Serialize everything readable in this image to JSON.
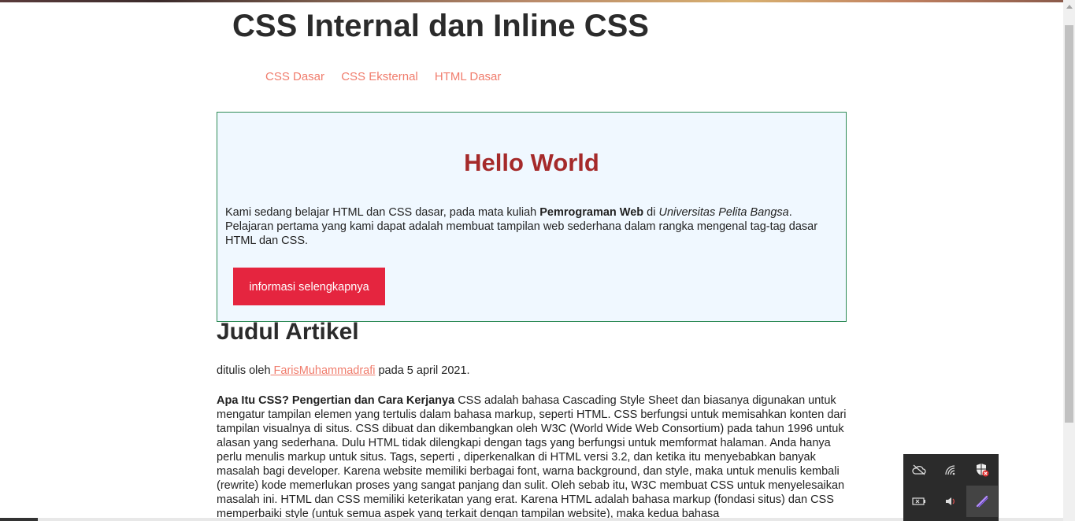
{
  "page": {
    "title": "CSS Internal dan Inline CSS",
    "nav": [
      "CSS Dasar",
      "CSS Eksternal",
      "HTML Dasar"
    ]
  },
  "hero": {
    "heading": "Hello World",
    "text_before": "Kami sedang belajar HTML dan CSS dasar, pada mata kuliah ",
    "bold_course": "Pemrograman Web",
    "text_mid": " di ",
    "italic_univ": "Universitas Pelita Bangsa",
    "text_after": ". Pelajaran pertama yang kami dapat adalah membuat tampilan web sederhana dalam rangka mengenal tag-tag dasar HTML dan CSS.",
    "button_label": "informasi selengkapnya"
  },
  "article": {
    "title": "Judul Artikel",
    "byline_prefix": "ditulis oleh",
    "author": " FarisMuhammadrafi",
    "byline_suffix": " pada 5 april 2021.",
    "lead_bold": "Apa Itu CSS? Pengertian dan Cara Kerjanya",
    "body": " CSS adalah bahasa Cascading Style Sheet dan biasanya digunakan untuk mengatur tampilan elemen yang tertulis dalam bahasa markup, seperti HTML. CSS berfungsi untuk memisahkan konten dari tampilan visualnya di situs. CSS dibuat dan dikembangkan oleh W3C (World Wide Web Consortium) pada tahun 1996 untuk alasan yang sederhana. Dulu HTML tidak dilengkapi dengan tags yang berfungsi untuk memformat halaman. Anda hanya perlu menulis markup untuk situs. Tags, seperti , diperkenalkan di HTML versi 3.2, dan ketika itu menyebabkan banyak masalah bagi developer. Karena website memiliki berbagai font, warna background, dan style, maka untuk menulis kembali (rewrite) kode memerlukan proses yang sangat panjang dan sulit. Oleh sebab itu, W3C membuat CSS untuk menyelesaikan masalah ini. HTML dan CSS memiliki keterikatan yang erat. Karena HTML adalah bahasa markup (fondasi situs) dan CSS memperbaiki style (untuk semua aspek yang terkait dengan tampilan website), maka kedua bahasa"
  },
  "tray": {
    "icons": [
      "cloud-offline-icon",
      "wifi-icon",
      "security-shield-icon",
      "battery-icon",
      "volume-icon",
      "pen-icon"
    ]
  },
  "colors": {
    "nav_link": "#f07c6c",
    "hero_bg": "#f0f8ff",
    "hero_border": "#2e8b57",
    "hero_heading": "#a52a2a",
    "button_bg": "#e5253f"
  }
}
